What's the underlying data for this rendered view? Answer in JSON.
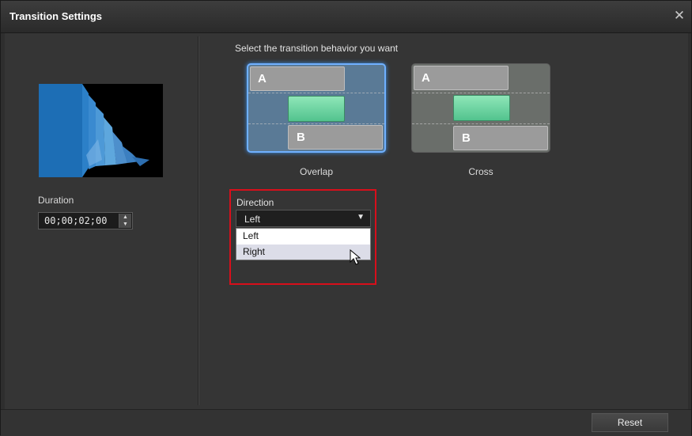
{
  "window": {
    "title": "Transition Settings"
  },
  "left_panel": {
    "duration_label": "Duration",
    "duration_value": "00;00;02;00"
  },
  "main": {
    "heading": "Select the transition behavior you want",
    "options": [
      {
        "label": "Overlap",
        "track_a": "A",
        "track_b": "B",
        "selected": true
      },
      {
        "label": "Cross",
        "track_a": "A",
        "track_b": "B",
        "selected": false
      }
    ],
    "direction": {
      "label": "Direction",
      "selected": "Left",
      "options": [
        "Left",
        "Right"
      ]
    }
  },
  "footer": {
    "reset_label": "Reset"
  },
  "colors": {
    "highlight_box": "#d80f1b",
    "selected_border": "#6fb0ff",
    "middle_clip": "#52c38e"
  }
}
